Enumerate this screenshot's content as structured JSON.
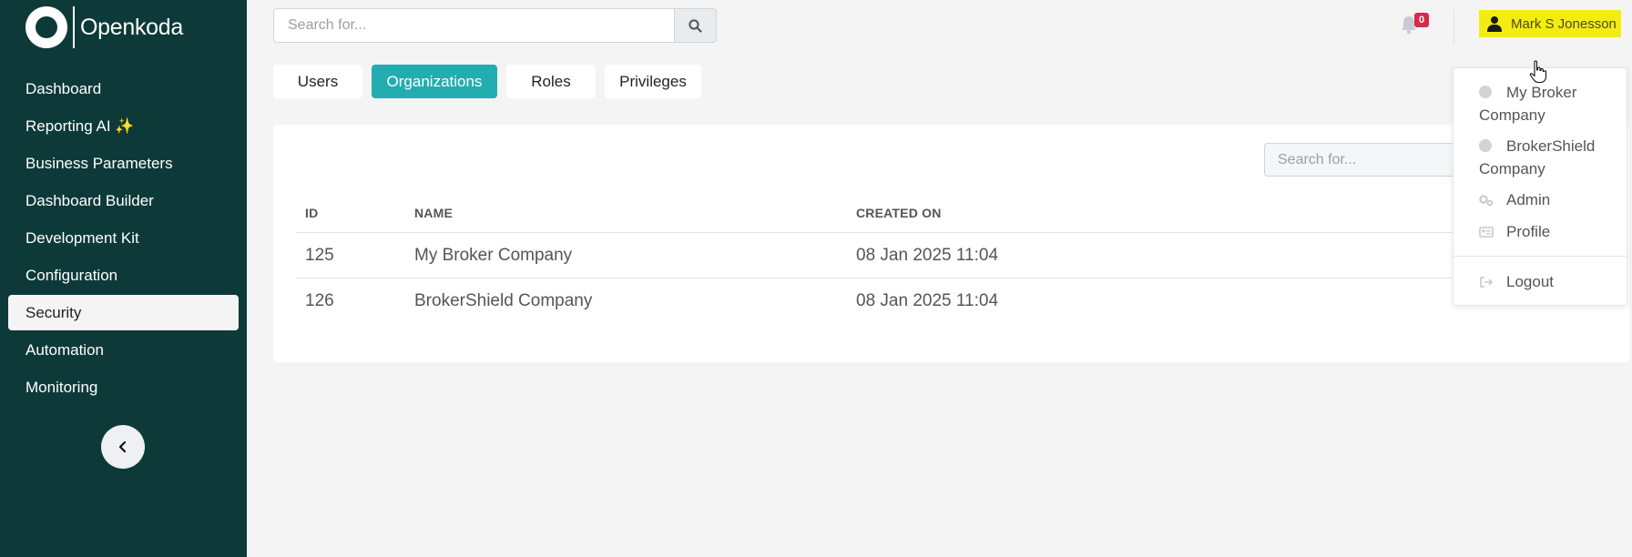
{
  "app": {
    "logo_text": "Openkoda"
  },
  "sidebar": {
    "items": [
      {
        "label": "Dashboard"
      },
      {
        "label": "Reporting AI ✨"
      },
      {
        "label": "Business Parameters"
      },
      {
        "label": "Dashboard Builder"
      },
      {
        "label": "Development Kit"
      },
      {
        "label": "Configuration"
      },
      {
        "label": "Security",
        "active": true
      },
      {
        "label": "Automation"
      },
      {
        "label": "Monitoring"
      }
    ],
    "collapse_icon": "chevron-left-icon"
  },
  "header": {
    "search": {
      "placeholder": "Search for...",
      "value": ""
    },
    "notifications": {
      "count": "0",
      "icon": "bell-icon"
    },
    "user": {
      "name": "Mark S Jonesson",
      "icon": "user-icon"
    }
  },
  "tabs": [
    {
      "label": "Users"
    },
    {
      "label": "Organizations",
      "active": true
    },
    {
      "label": "Roles"
    },
    {
      "label": "Privileges"
    }
  ],
  "table": {
    "search": {
      "placeholder": "Search for..."
    },
    "columns": [
      "ID",
      "NAME",
      "CREATED ON"
    ],
    "rows": [
      {
        "id": "125",
        "name": "My Broker Company",
        "created_on": "08 Jan 2025 11:04"
      },
      {
        "id": "126",
        "name": "BrokerShield Company",
        "created_on": "08 Jan 2025 11:04"
      }
    ]
  },
  "user_menu": {
    "organizations": [
      {
        "line1": "My Broker",
        "line2": "Company"
      },
      {
        "line1": "BrokerShield",
        "line2": "Company"
      }
    ],
    "admin_label": "Admin",
    "profile_label": "Profile",
    "logout_label": "Logout"
  },
  "colors": {
    "sidebar_bg": "#0d3a38",
    "accent": "#23adb0",
    "user_highlight": "#f3ec12",
    "badge": "#d62a4a"
  }
}
